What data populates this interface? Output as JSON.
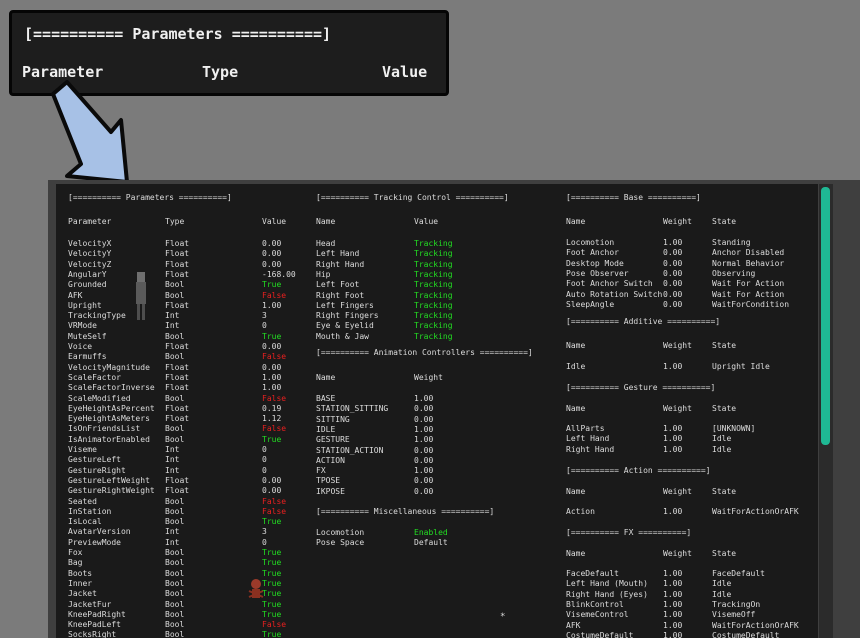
{
  "zoom": {
    "title": "[========== Parameters ==========]",
    "col_parameter": "Parameter",
    "col_type": "Type",
    "col_value": "Value"
  },
  "colors": {
    "true_color": "#22dd22",
    "false_color": "#e82020",
    "tracking_color": "#22dd22",
    "scrollbar": "#1fb894"
  },
  "params": {
    "title": "[========== Parameters ==========]",
    "headers": [
      "Parameter",
      "Type",
      "Value"
    ],
    "rows": [
      [
        "VelocityX",
        "Float",
        "0.00"
      ],
      [
        "VelocityY",
        "Float",
        "0.00"
      ],
      [
        "VelocityZ",
        "Float",
        "0.00"
      ],
      [
        "AngularY",
        "Float",
        "-168.00"
      ],
      [
        "Grounded",
        "Bool",
        "True"
      ],
      [
        "AFK",
        "Bool",
        "False"
      ],
      [
        "Upright",
        "Float",
        "1.00"
      ],
      [
        "TrackingType",
        "Int",
        "3"
      ],
      [
        "VRMode",
        "Int",
        "0"
      ],
      [
        "MuteSelf",
        "Bool",
        "True"
      ],
      [
        "Voice",
        "Float",
        "0.00"
      ],
      [
        "Earmuffs",
        "Bool",
        "False"
      ],
      [
        "VelocityMagnitude",
        "Float",
        "0.00"
      ],
      [
        "ScaleFactor",
        "Float",
        "1.00"
      ],
      [
        "ScaleFactorInverse",
        "Float",
        "1.00"
      ],
      [
        "ScaleModified",
        "Bool",
        "False"
      ],
      [
        "EyeHeightAsPercent",
        "Float",
        "0.19"
      ],
      [
        "EyeHeightAsMeters",
        "Float",
        "1.12"
      ],
      [
        "IsOnFriendsList",
        "Bool",
        "False"
      ],
      [
        "IsAnimatorEnabled",
        "Bool",
        "True"
      ],
      [
        "Viseme",
        "Int",
        "0"
      ],
      [
        "GestureLeft",
        "Int",
        "0"
      ],
      [
        "GestureRight",
        "Int",
        "0"
      ],
      [
        "GestureLeftWeight",
        "Float",
        "0.00"
      ],
      [
        "GestureRightWeight",
        "Float",
        "0.00"
      ],
      [
        "Seated",
        "Bool",
        "False"
      ],
      [
        "InStation",
        "Bool",
        "False"
      ],
      [
        "IsLocal",
        "Bool",
        "True"
      ],
      [
        "AvatarVersion",
        "Int",
        "3"
      ],
      [
        "PreviewMode",
        "Int",
        "0"
      ],
      [
        "Fox",
        "Bool",
        "True"
      ],
      [
        "Bag",
        "Bool",
        "True"
      ],
      [
        "Boots",
        "Bool",
        "True"
      ],
      [
        "Inner",
        "Bool",
        "True"
      ],
      [
        "Jacket",
        "Bool",
        "True"
      ],
      [
        "JacketFur",
        "Bool",
        "True"
      ],
      [
        "KneePadRight",
        "Bool",
        "True"
      ],
      [
        "KneePadLeft",
        "Bool",
        "False"
      ],
      [
        "SocksRight",
        "Bool",
        "True"
      ]
    ]
  },
  "tracking": {
    "title": "[========== Tracking Control ==========]",
    "headers": [
      "Name",
      "Value"
    ],
    "rows": [
      [
        "Head",
        "Tracking"
      ],
      [
        "Left Hand",
        "Tracking"
      ],
      [
        "Right Hand",
        "Tracking"
      ],
      [
        "Hip",
        "Tracking"
      ],
      [
        "Left Foot",
        "Tracking"
      ],
      [
        "Right Foot",
        "Tracking"
      ],
      [
        "Left Fingers",
        "Tracking"
      ],
      [
        "Right Fingers",
        "Tracking"
      ],
      [
        "Eye & Eyelid",
        "Tracking"
      ],
      [
        "Mouth & Jaw",
        "Tracking"
      ]
    ]
  },
  "anim": {
    "title": "[========== Animation Controllers ==========]",
    "headers": [
      "Name",
      "Weight"
    ],
    "rows": [
      [
        "BASE",
        "1.00"
      ],
      [
        "STATION_SITTING",
        "0.00"
      ],
      [
        "SITTING",
        "0.00"
      ],
      [
        "IDLE",
        "1.00"
      ],
      [
        "GESTURE",
        "1.00"
      ],
      [
        "STATION_ACTION",
        "0.00"
      ],
      [
        "ACTION",
        "0.00"
      ],
      [
        "FX",
        "1.00"
      ],
      [
        "TPOSE",
        "0.00"
      ],
      [
        "IKPOSE",
        "0.00"
      ]
    ],
    "marker": "*"
  },
  "misc": {
    "title": "[========== Miscellaneous ==========]",
    "rows": [
      [
        "Locomotion",
        "Enabled"
      ],
      [
        "Pose Space",
        "Default"
      ]
    ]
  },
  "base": {
    "title": "[========== Base ==========]",
    "headers": [
      "Name",
      "Weight",
      "State"
    ],
    "rows": [
      [
        "Locomotion",
        "1.00",
        "Standing"
      ],
      [
        "Foot Anchor",
        "0.00",
        "Anchor Disabled"
      ],
      [
        "Desktop Mode",
        "0.00",
        "Normal Behavior"
      ],
      [
        "Pose Observer",
        "0.00",
        "Observing"
      ],
      [
        "Foot Anchor Switch",
        "0.00",
        "Wait For Action"
      ],
      [
        "Auto Rotation Switch",
        "0.00",
        "Wait For Action"
      ],
      [
        "SleepAngle",
        "0.00",
        "WaitForCondition"
      ]
    ]
  },
  "additive": {
    "title": "[========== Additive ==========]",
    "headers": [
      "Name",
      "Weight",
      "State"
    ],
    "rows": [
      [
        "Idle",
        "1.00",
        "Upright Idle"
      ]
    ]
  },
  "gesture": {
    "title": "[========== Gesture ==========]",
    "headers": [
      "Name",
      "Weight",
      "State"
    ],
    "rows": [
      [
        "AllParts",
        "1.00",
        "[UNKNOWN]"
      ],
      [
        "Left Hand",
        "1.00",
        "Idle"
      ],
      [
        "Right Hand",
        "1.00",
        "Idle"
      ]
    ]
  },
  "action": {
    "title": "[========== Action ==========]",
    "headers": [
      "Name",
      "Weight",
      "State"
    ],
    "rows": [
      [
        "Action",
        "1.00",
        "WaitForActionOrAFK"
      ]
    ]
  },
  "fx": {
    "title": "[========== FX ==========]",
    "headers": [
      "Name",
      "Weight",
      "State"
    ],
    "rows": [
      [
        "FaceDefault",
        "1.00",
        "FaceDefault"
      ],
      [
        "Left Hand (Mouth)",
        "1.00",
        "Idle"
      ],
      [
        "Right Hand (Eyes)",
        "1.00",
        "Idle"
      ],
      [
        "BlinkControl",
        "1.00",
        "TrackingOn"
      ],
      [
        "VisemeControl",
        "1.00",
        "VisemeOff"
      ],
      [
        "AFK",
        "1.00",
        "WaitForActionOrAFK"
      ],
      [
        "CostumeDefault",
        "1.00",
        "CostumeDefault"
      ]
    ]
  }
}
